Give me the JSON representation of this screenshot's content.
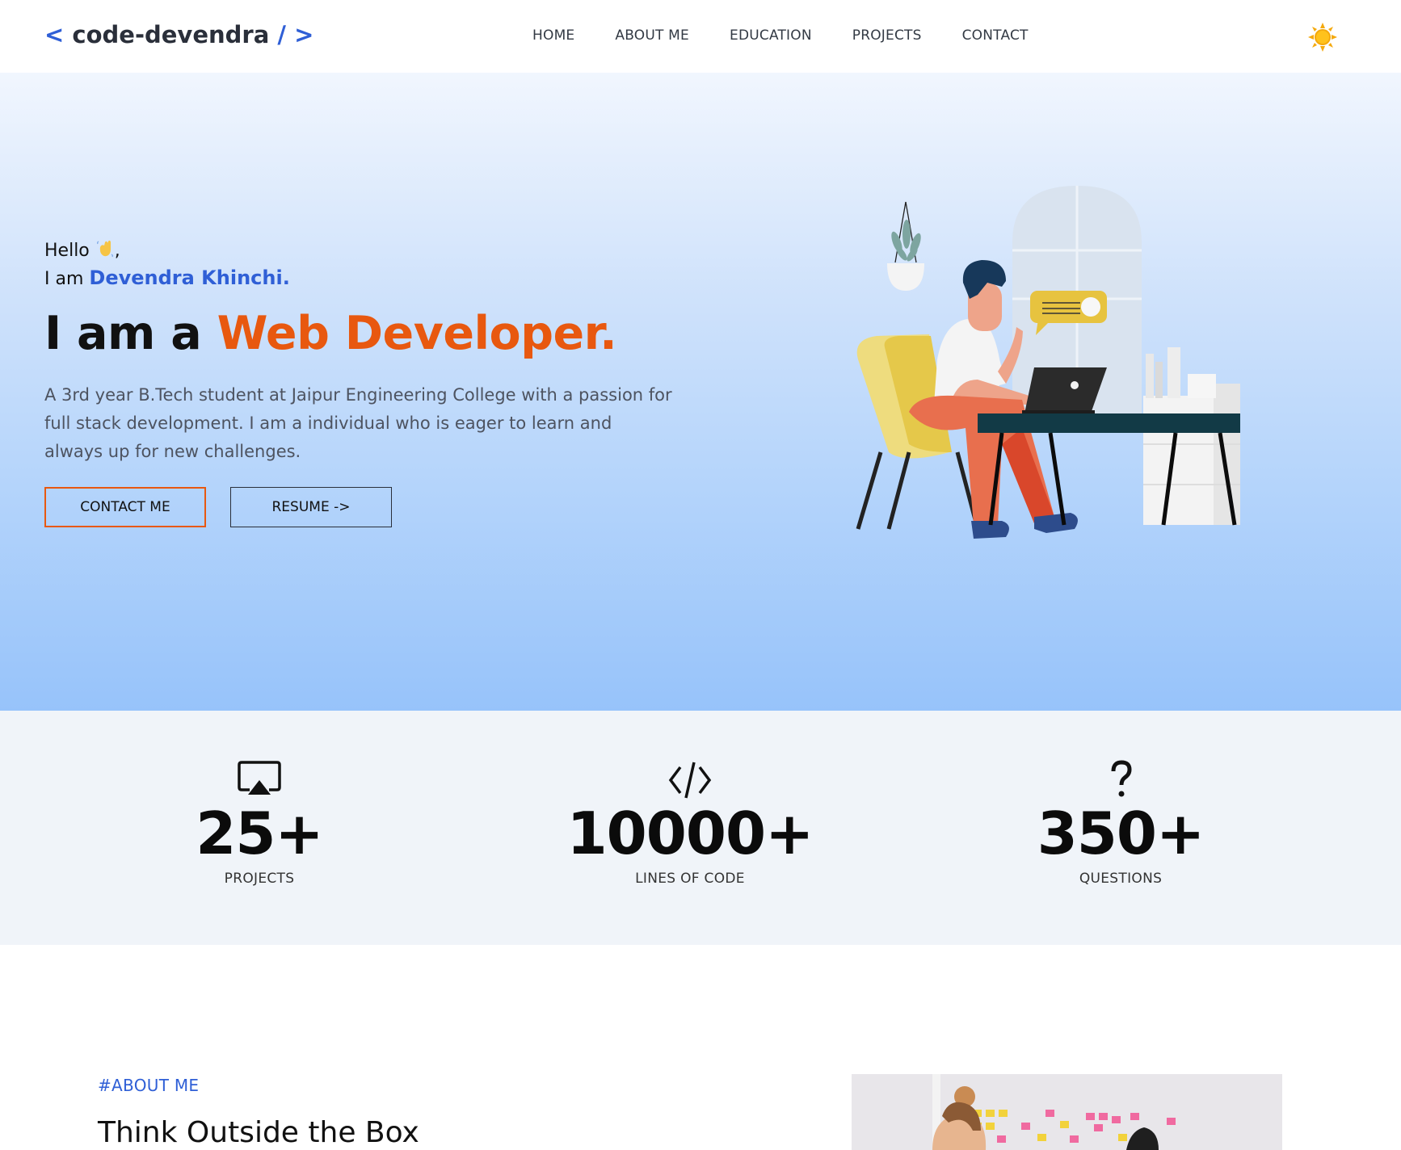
{
  "nav": {
    "logo_open": "<",
    "logo_text": "code-devendra",
    "logo_close": "/ >",
    "items": [
      {
        "label": "HOME"
      },
      {
        "label": "ABOUT ME"
      },
      {
        "label": "EDUCATION"
      },
      {
        "label": "PROJECTS"
      },
      {
        "label": "CONTACT"
      }
    ],
    "theme_icon": "sun-icon"
  },
  "hero": {
    "hello": "Hello",
    "hello_emoji": "waving-hand-icon",
    "hello_comma": ",",
    "iam": "I am",
    "name": "Devendra Khinchi.",
    "headline_prefix": "I am a",
    "headline_role": "Web Developer.",
    "description": "A 3rd year B.Tech student at Jaipur Engineering College with a passion for full stack development. I am a individual who is eager to learn and always up for new challenges.",
    "contact_btn": "CONTACT ME",
    "resume_btn": "RESUME ->",
    "illustration": "developer-at-desk-illustration"
  },
  "stats": [
    {
      "icon": "cast-screen-icon",
      "value": "25+",
      "label": "PROJECTS"
    },
    {
      "icon": "code-icon",
      "value": "10000+",
      "label": "LINES OF CODE"
    },
    {
      "icon": "question-icon",
      "value": "350+",
      "label": "QUESTIONS"
    }
  ],
  "about": {
    "tag": "#ABOUT ME",
    "title": "Think Outside the Box",
    "image": "team-sticky-notes-photo"
  },
  "colors": {
    "accent_blue": "#2f5fd6",
    "accent_orange": "#e8580f"
  }
}
